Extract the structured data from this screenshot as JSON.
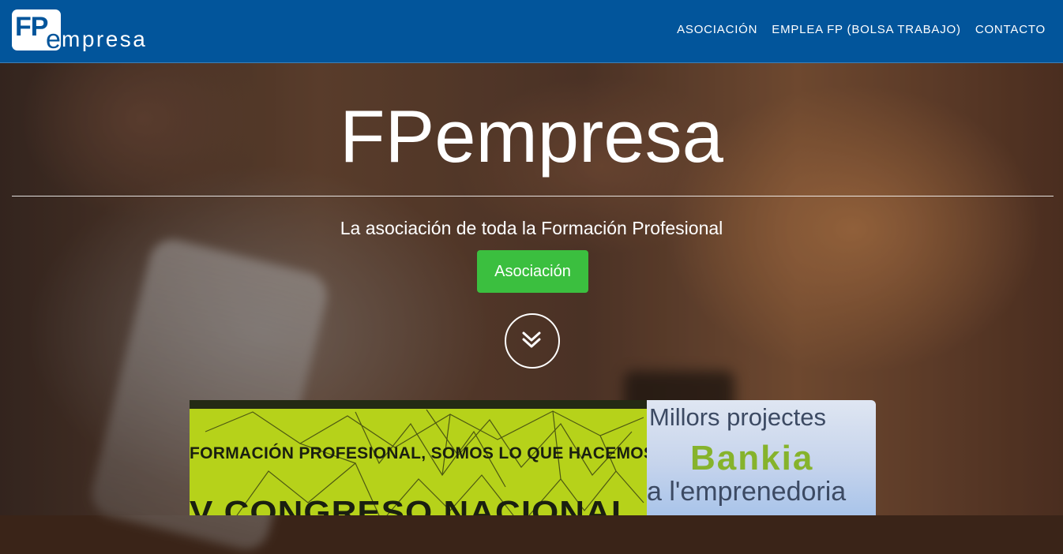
{
  "nav": {
    "logo_fp": "FP",
    "logo_e": "e",
    "logo_rest": "mpresa",
    "links": [
      {
        "label": "ASOCIACIÓN"
      },
      {
        "label": "EMPLEA FP (BOLSA TRABAJO)"
      },
      {
        "label": "CONTACTO"
      }
    ]
  },
  "hero": {
    "title": "FPempresa",
    "subtitle": "La asociación de toda la Formación Profesional",
    "button_label": "Asociación",
    "scroll_icon": "double-chevron-down-icon"
  },
  "cards": {
    "left": {
      "line1": "FORMACIÓN PROFESIONAL, SOMOS LO QUE HACEMOS",
      "line2": "V CONGRESO NACIONAL"
    },
    "right": {
      "line1": "Millors projectes",
      "line2": "Bankia",
      "line3": "a l'emprenedoria"
    }
  },
  "colors": {
    "navbar": "#02559b",
    "button": "#3bbf3f",
    "card_left": "#b6d21a",
    "bankia_green": "#86b32c"
  }
}
